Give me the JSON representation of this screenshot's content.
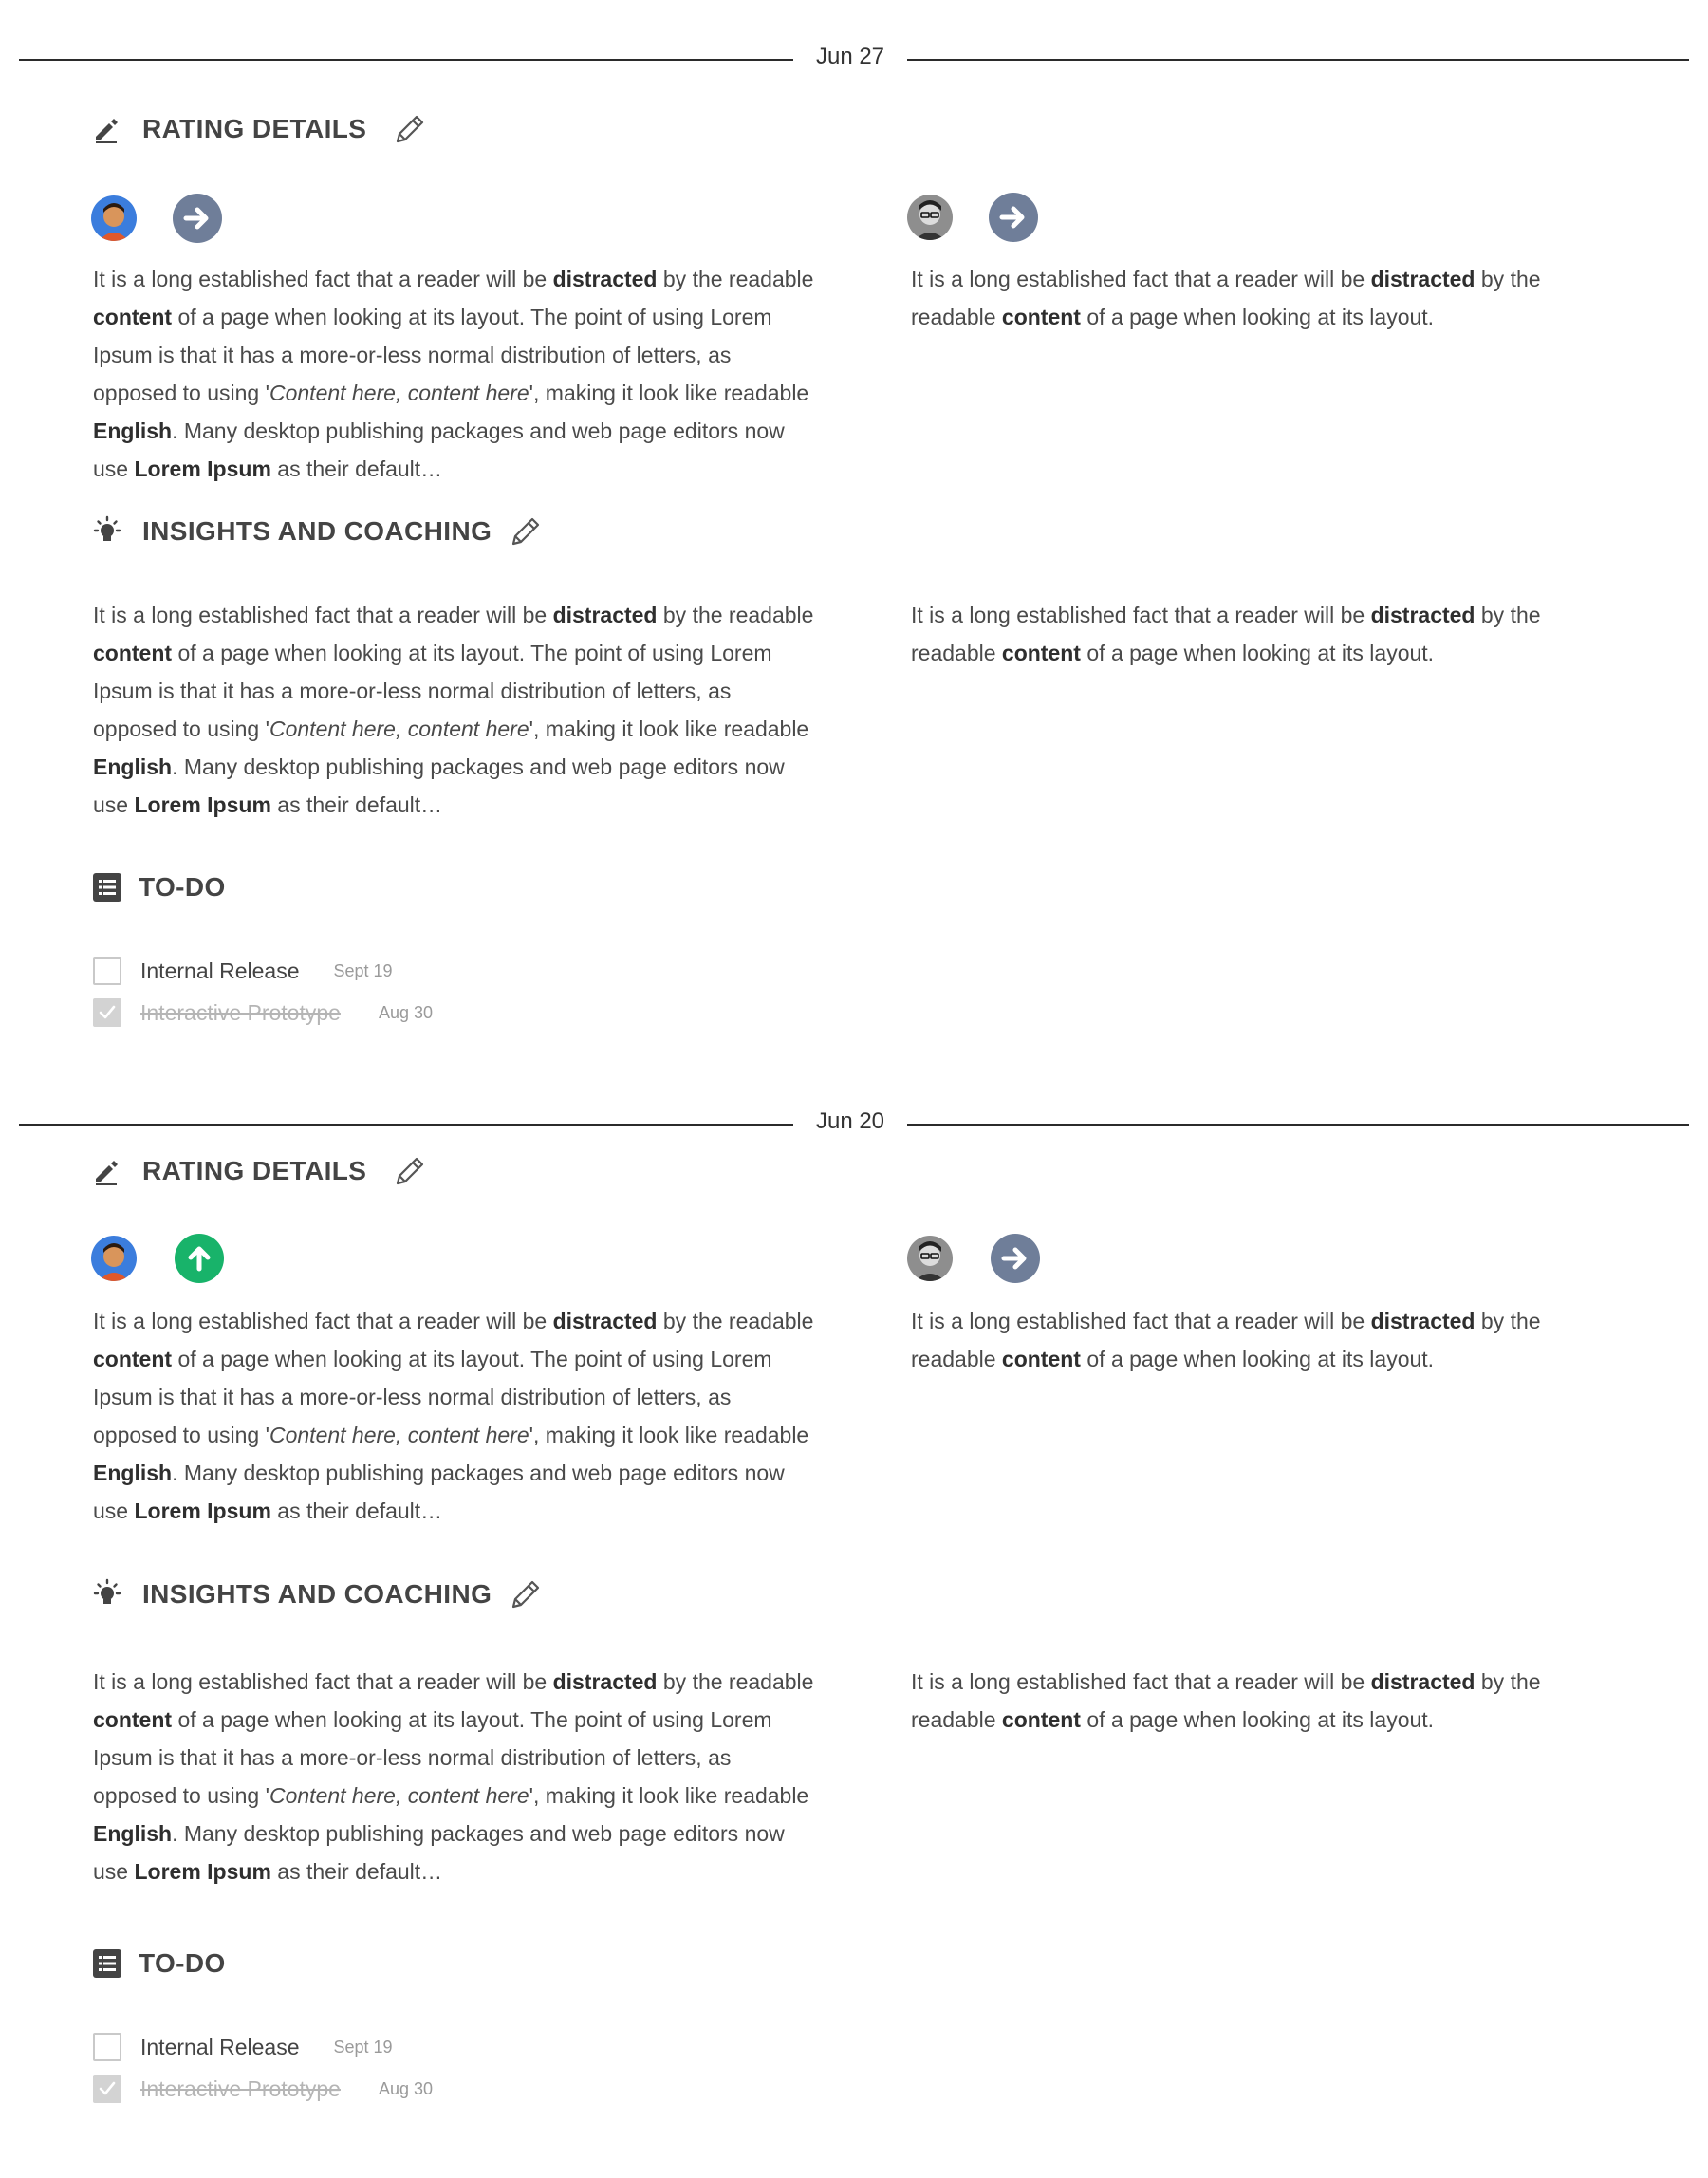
{
  "entries": [
    {
      "date": "Jun 27",
      "rating": {
        "title": "RATING DETAILS",
        "left_trend": "neutral",
        "right_trend": "neutral"
      },
      "insights": {
        "title": "INSIGHTS AND COACHING"
      },
      "todo": {
        "title": "TO-DO",
        "items": [
          {
            "label": "Internal Release",
            "date": "Sept 19",
            "done": false
          },
          {
            "label": "Interactive Prototype",
            "date": "Aug 30",
            "done": true
          }
        ]
      }
    },
    {
      "date": "Jun 20",
      "rating": {
        "title": "RATING DETAILS",
        "left_trend": "up",
        "right_trend": "neutral"
      },
      "insights": {
        "title": "INSIGHTS AND COACHING"
      },
      "todo": {
        "title": "TO-DO",
        "items": [
          {
            "label": "Internal Release",
            "date": "Sept 19",
            "done": false
          },
          {
            "label": "Interactive Prototype",
            "date": "Aug 30",
            "done": true
          }
        ]
      }
    }
  ],
  "long_text": {
    "p1": "It is a long established fact that a reader will be ",
    "b1": "distracted",
    "p2": " by the readable ",
    "b2": "content",
    "p3": " of a page when looking at its layout. The point of using Lorem Ipsum is that it has a more-or-less normal distribution of letters, as opposed to using '",
    "i1": "Content here, content here",
    "p4": "', making it look like readable ",
    "b3": "English",
    "p5": ". Many desktop publishing packages and web page editors now use ",
    "b4": "Lorem Ipsum",
    "p6": " as their default…"
  },
  "short_text": {
    "p1": "It is a long established fact that a reader will be ",
    "b1": "distracted",
    "p2": " by the readable ",
    "b2": "content",
    "p3": " of a page when looking at its layout."
  },
  "colors": {
    "neutral_badge": "#6f7e99",
    "up_badge": "#18b36a",
    "divider": "#2b2b2b"
  },
  "icons": {
    "rating": "pencil-icon",
    "edit": "edit-pencil-icon",
    "insights": "lightbulb-icon",
    "todo": "list-icon",
    "trend_neutral": "arrow-right-icon",
    "trend_up": "arrow-up-icon"
  }
}
